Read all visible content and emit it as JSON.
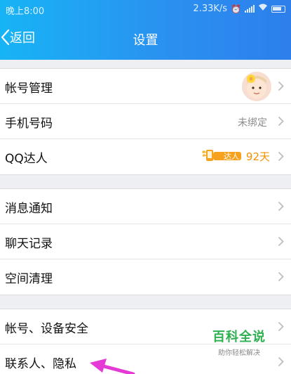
{
  "statusbar": {
    "time": "晚上8:00",
    "speed": "2.33K/s"
  },
  "nav": {
    "back_label": "返回",
    "title": "设置"
  },
  "groups": [
    {
      "items": [
        {
          "label": "帐号管理"
        },
        {
          "label": "手机号码",
          "value": "未绑定"
        },
        {
          "label": "QQ达人",
          "badge": "达人",
          "days": "92天"
        }
      ]
    },
    {
      "items": [
        {
          "label": "消息通知"
        },
        {
          "label": "聊天记录"
        },
        {
          "label": "空间清理"
        }
      ]
    },
    {
      "items": [
        {
          "label": "帐号、设备安全"
        },
        {
          "label": "联系人、隐私"
        }
      ]
    }
  ],
  "watermark": {
    "main": "百科全说",
    "sub": "助你轻松解决"
  },
  "colors": {
    "header_start": "#17b4f5",
    "header_end": "#2d7fec",
    "accent_orange": "#f29300",
    "annotation_pink": "#e63ad6"
  }
}
